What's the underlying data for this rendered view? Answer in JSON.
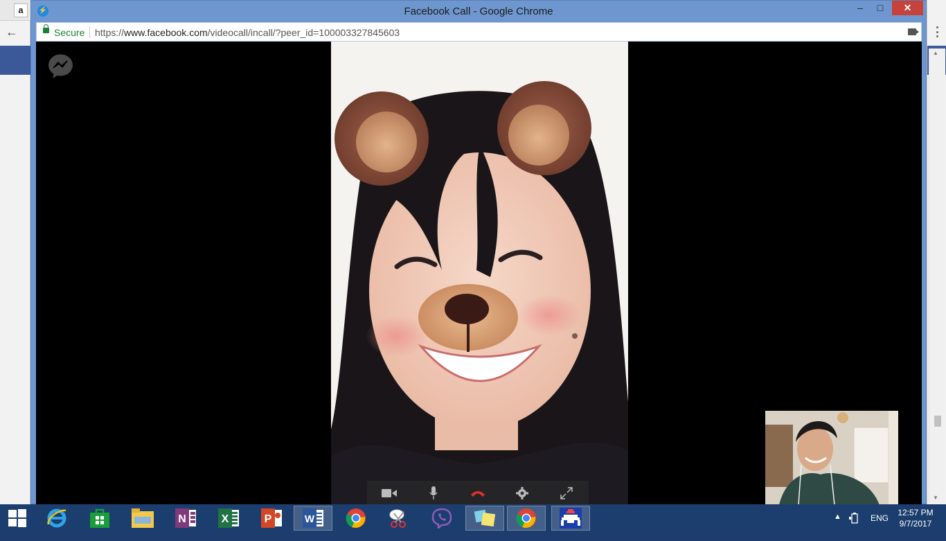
{
  "background_window": {
    "tab_favicon_letter": "a"
  },
  "window": {
    "title": "Facebook Call - Google Chrome",
    "controls": {
      "minimize": "–",
      "maximize": "□",
      "close": "✕"
    }
  },
  "address_bar": {
    "security_label": "Secure",
    "url_scheme": "https://",
    "url_host": "www.facebook.com",
    "url_path": "/videocall/incall/?peer_id=100003327845603"
  },
  "call": {
    "controls": [
      {
        "name": "camera-toggle-button",
        "icon": "video-camera-icon"
      },
      {
        "name": "microphone-toggle-button",
        "icon": "microphone-icon"
      },
      {
        "name": "end-call-button",
        "icon": "hang-up-icon"
      },
      {
        "name": "settings-button",
        "icon": "gear-icon"
      },
      {
        "name": "fullscreen-button",
        "icon": "expand-icon"
      }
    ],
    "end_call_color": "#e0302b"
  },
  "taskbar": {
    "apps": [
      {
        "name": "internet-explorer",
        "icon": "internet-explorer-icon"
      },
      {
        "name": "store",
        "icon": "store-icon"
      },
      {
        "name": "file-explorer",
        "icon": "folder-icon"
      },
      {
        "name": "onenote",
        "icon": "onenote-icon"
      },
      {
        "name": "excel",
        "icon": "excel-icon"
      },
      {
        "name": "powerpoint",
        "icon": "powerpoint-icon"
      },
      {
        "name": "word",
        "icon": "word-icon"
      },
      {
        "name": "chrome",
        "icon": "chrome-icon"
      },
      {
        "name": "snipping-tool",
        "icon": "scissors-icon"
      },
      {
        "name": "viber",
        "icon": "viber-icon"
      },
      {
        "name": "sticky-notes",
        "icon": "sticky-notes-icon"
      },
      {
        "name": "chrome-active",
        "icon": "chrome-icon"
      },
      {
        "name": "game-app",
        "icon": "pixel-creature-icon"
      }
    ],
    "tray": {
      "chevron": "▲",
      "language": "ENG",
      "time": "12:57 PM",
      "date": "9/7/2017"
    }
  }
}
